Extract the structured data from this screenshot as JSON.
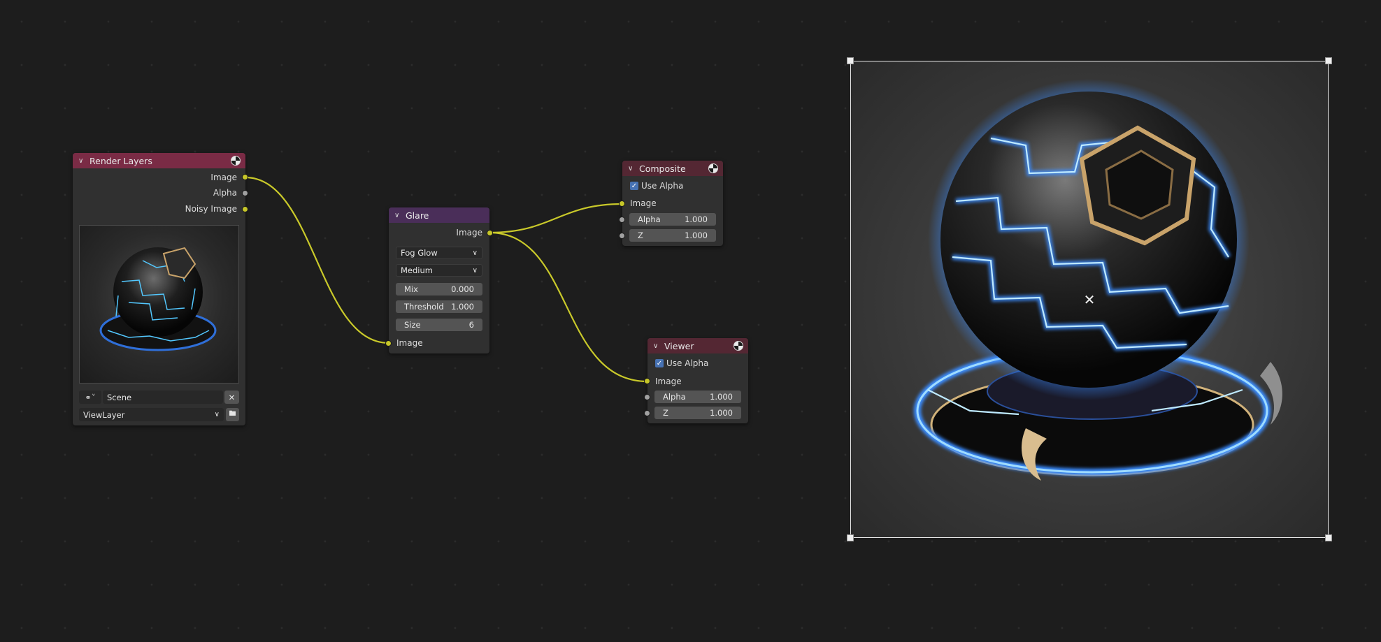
{
  "render_layers": {
    "title": "Render Layers",
    "outputs": [
      "Image",
      "Alpha",
      "Noisy Image"
    ],
    "scene_value": "Scene",
    "view_layer_value": "ViewLayer",
    "header_color": "#7a2b45"
  },
  "glare": {
    "title": "Glare",
    "output": "Image",
    "glare_type": "Fog Glow",
    "quality": "Medium",
    "fields": [
      {
        "label": "Mix",
        "value": "0.000"
      },
      {
        "label": "Threshold",
        "value": "1.000"
      },
      {
        "label": "Size",
        "value": "6"
      }
    ],
    "input": "Image",
    "header_color": "#4a2e59"
  },
  "composite": {
    "title": "Composite",
    "use_alpha_label": "Use Alpha",
    "use_alpha_checked": true,
    "input": "Image",
    "fields": [
      {
        "label": "Alpha",
        "value": "1.000"
      },
      {
        "label": "Z",
        "value": "1.000"
      }
    ]
  },
  "viewer": {
    "title": "Viewer",
    "use_alpha_label": "Use Alpha",
    "use_alpha_checked": true,
    "input": "Image",
    "fields": [
      {
        "label": "Alpha",
        "value": "1.000"
      },
      {
        "label": "Z",
        "value": "1.000"
      }
    ]
  },
  "colors": {
    "link": "#c9c92a",
    "socket_image": "#c7c729",
    "socket_value": "#a1a1a1",
    "accent_glow": "#3a8cff",
    "backdrop_border": "#e8e8e8"
  }
}
